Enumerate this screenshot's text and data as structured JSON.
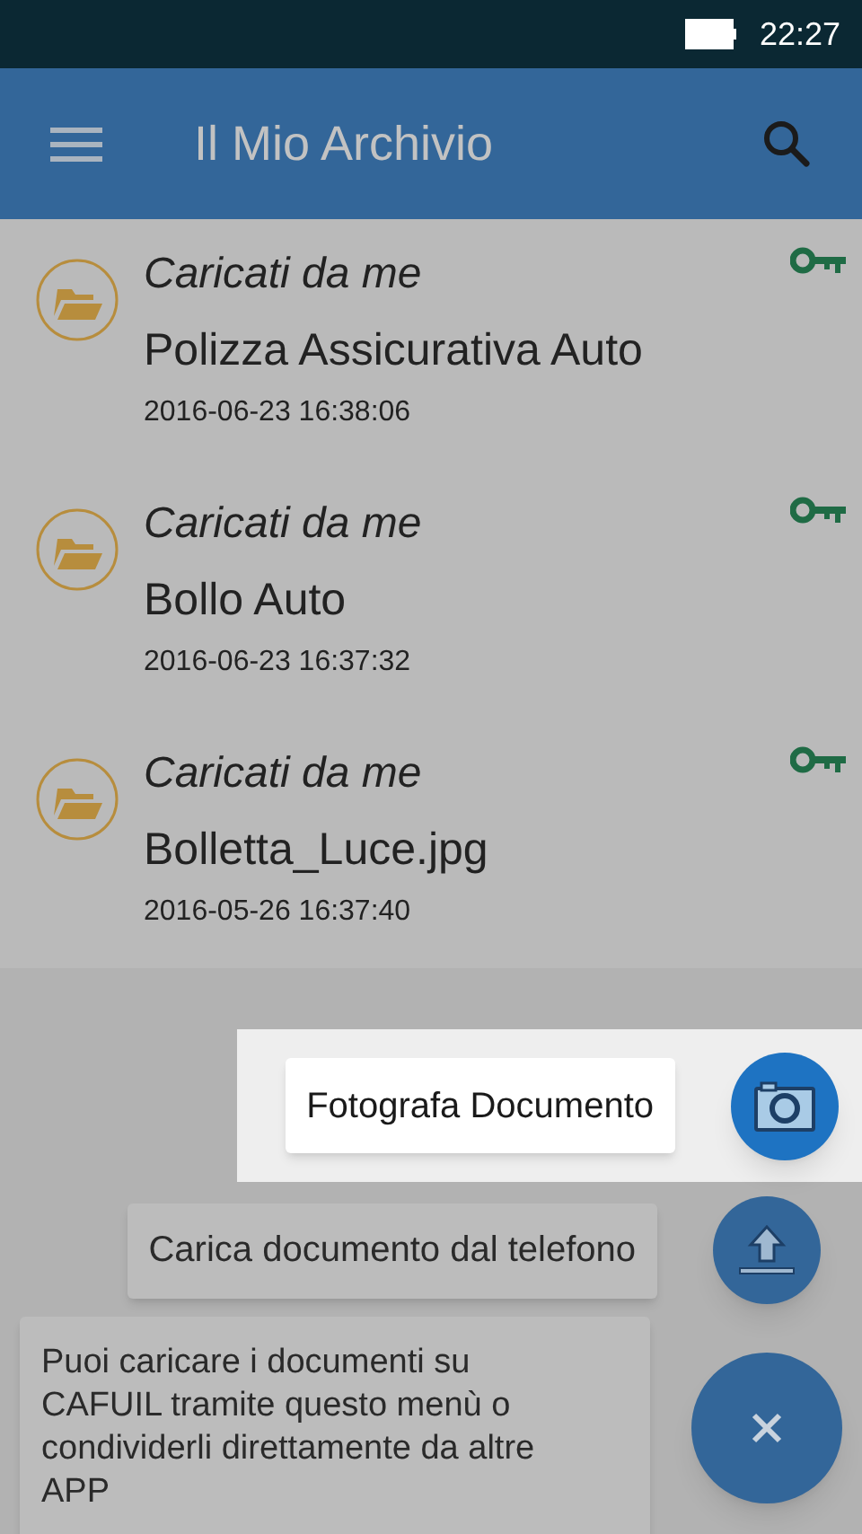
{
  "status_bar": {
    "time": "22:27"
  },
  "app_bar": {
    "title": "Il Mio Archivio"
  },
  "documents": [
    {
      "category": "Caricati da me",
      "name": "Polizza Assicurativa Auto",
      "date": "2016-06-23 16:38:06"
    },
    {
      "category": "Caricati da me",
      "name": "Bollo Auto",
      "date": "2016-06-23 16:37:32"
    },
    {
      "category": "Caricati da me",
      "name": "Bolletta_Luce.jpg",
      "date": "2016-05-26 16:37:40"
    }
  ],
  "fab_actions": [
    {
      "kind": "camera",
      "label": "Fotografa Documento",
      "highlighted": true
    },
    {
      "kind": "upload",
      "label": "Carica documento dal telefono",
      "highlighted": false
    }
  ],
  "hint": "Puoi caricare i documenti su CAFUIL tramite questo menù o condividerli direttamente da altre APP"
}
